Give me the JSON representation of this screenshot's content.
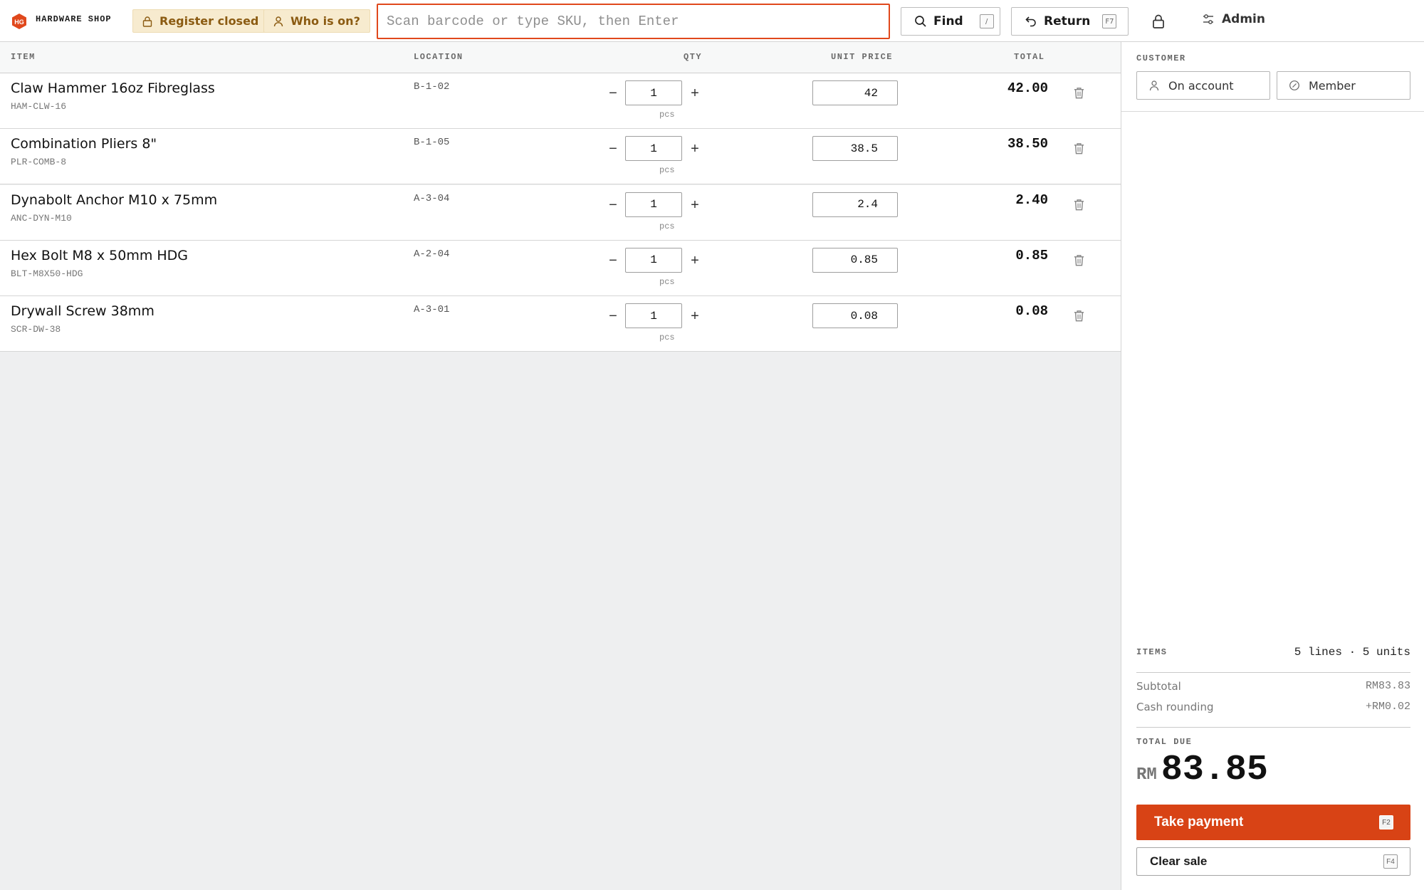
{
  "brand": {
    "logo_text": "HG",
    "name": "HARDWARE SHOP",
    "accent_color": "#e0481c"
  },
  "header": {
    "register_status": "Register closed",
    "staff_label": "Who is on?",
    "scan_placeholder": "Scan barcode or type SKU, then Enter",
    "find_label": "Find",
    "find_shortcut": "/",
    "return_label": "Return",
    "return_shortcut": "F7",
    "lock_icon": "lock-icon",
    "admin_label": "Admin"
  },
  "table": {
    "headers": {
      "item": "ITEM",
      "location": "LOCATION",
      "qty": "QTY",
      "unit_price": "UNIT PRICE",
      "total": "TOTAL"
    },
    "rows": [
      {
        "name": "Claw Hammer 16oz Fibreglass",
        "sku": "HAM-CLW-16",
        "location": "B-1-02",
        "qty": "1",
        "unit": "pcs",
        "price": "42",
        "total": "42.00"
      },
      {
        "name": "Combination Pliers 8\"",
        "sku": "PLR-COMB-8",
        "location": "B-1-05",
        "qty": "1",
        "unit": "pcs",
        "price": "38.5",
        "total": "38.50"
      },
      {
        "name": "Dynabolt Anchor M10 x 75mm",
        "sku": "ANC-DYN-M10",
        "location": "A-3-04",
        "qty": "1",
        "unit": "pcs",
        "price": "2.4",
        "total": "2.40"
      },
      {
        "name": "Hex Bolt M8 x 50mm HDG",
        "sku": "BLT-M8X50-HDG",
        "location": "A-2-04",
        "qty": "1",
        "unit": "pcs",
        "price": "0.85",
        "total": "0.85"
      },
      {
        "name": "Drywall Screw 38mm",
        "sku": "SCR-DW-38",
        "location": "A-3-01",
        "qty": "1",
        "unit": "pcs",
        "price": "0.08",
        "total": "0.08"
      }
    ]
  },
  "sidebar": {
    "customer_label": "CUSTOMER",
    "on_account_label": "On account",
    "member_label": "Member",
    "items_label": "ITEMS",
    "items_summary": "5 lines · 5 units",
    "subtotal_label": "Subtotal",
    "subtotal_value": "RM83.83",
    "rounding_label": "Cash rounding",
    "rounding_value": "+RM0.02",
    "total_due_label": "TOTAL DUE",
    "currency": "RM",
    "total_due_value": "83.85",
    "pay_label": "Take payment",
    "pay_shortcut": "F2",
    "clear_label": "Clear sale",
    "clear_shortcut": "F4"
  }
}
